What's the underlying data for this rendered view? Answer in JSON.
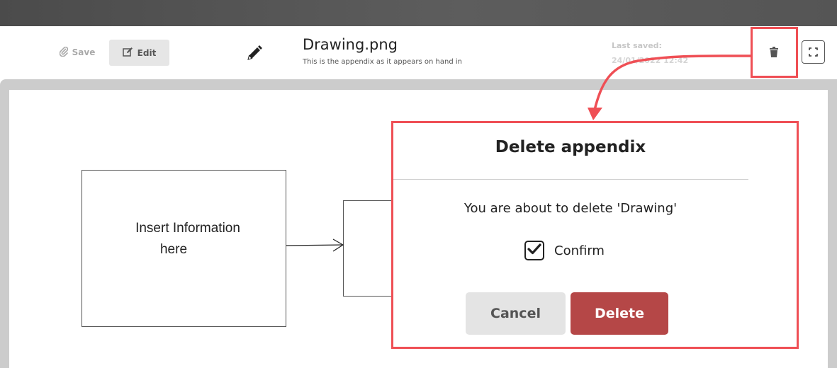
{
  "toolbar": {
    "save_label": "Save",
    "edit_label": "Edit",
    "file_title": "Drawing.png",
    "file_subtitle": "This is the appendix as it appears on hand in",
    "last_saved_label": "Last saved:",
    "last_saved_value": "24/01/2022 12:42"
  },
  "drawing": {
    "box_text_line1": "Insert Information",
    "box_text_line2": "here"
  },
  "dialog": {
    "title": "Delete appendix",
    "message": "You are about to delete 'Drawing'",
    "confirm_label": "Confirm",
    "confirm_checked": true,
    "cancel_label": "Cancel",
    "delete_label": "Delete"
  },
  "colors": {
    "accent_highlight": "#ef4f55",
    "delete_button": "#b54747",
    "topbar": "#555555"
  },
  "icons": [
    "paperclip-icon",
    "edit-icon",
    "pencil-icon",
    "trash-icon",
    "fullscreen-icon",
    "checkmark-icon"
  ]
}
